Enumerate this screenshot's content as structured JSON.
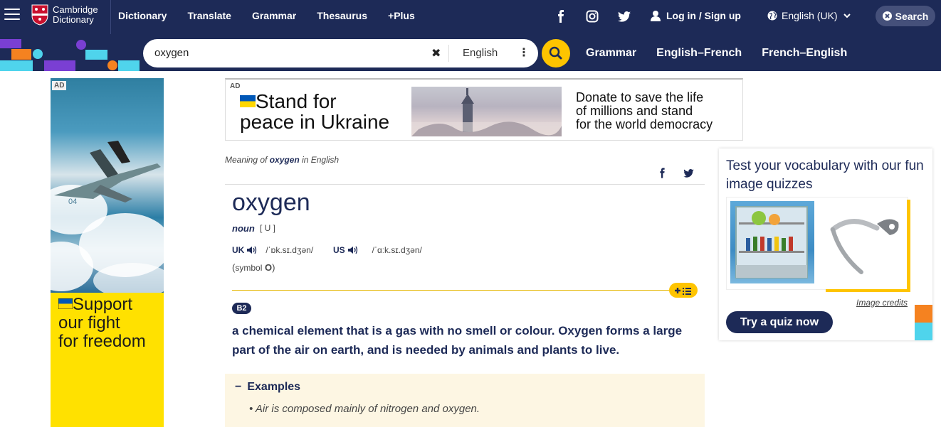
{
  "header": {
    "brand_line1": "Cambridge",
    "brand_line2": "Dictionary",
    "nav": [
      "Dictionary",
      "Translate",
      "Grammar",
      "Thesaurus",
      "+Plus"
    ],
    "login": "Log in / Sign up",
    "language": "English (UK)",
    "search_button": "Search",
    "social_icons": [
      "facebook-icon",
      "instagram-icon",
      "twitter-icon"
    ]
  },
  "search": {
    "value": "oxygen",
    "dictionary": "English",
    "links": [
      "Grammar",
      "English–French",
      "French–English"
    ]
  },
  "left_ad": {
    "tag": "AD",
    "text_line1": "Support",
    "text_line2": "our fight",
    "text_line3": "for freedom",
    "plane_number": "04"
  },
  "banner_ad": {
    "tag": "AD",
    "headline_line1": "Stand for",
    "headline_line2": "peace in Ukraine",
    "desc_line1": "Donate to save the life",
    "desc_line2": "of millions and stand",
    "desc_line3": "for the world democracy"
  },
  "entry": {
    "meaning_prefix": "Meaning of",
    "meaning_word": "oxygen",
    "meaning_suffix": "in English",
    "headword": "oxygen",
    "pos": "noun",
    "grammar": "[ U ]",
    "uk_label": "UK",
    "uk_ipa": "/ˈɒk.sɪ.dʒən/",
    "us_label": "US",
    "us_ipa": "/ˈɑːk.sɪ.dʒən/",
    "symbol_label": "symbol",
    "symbol_value": "O",
    "level": "B2",
    "definition": "a chemical element that is a gas with no smell or colour. Oxygen forms a large part of the air on earth, and is needed by animals and plants to live.",
    "examples_title": "Examples",
    "example1": "Air is composed mainly of nitrogen and oxygen."
  },
  "quiz": {
    "title": "Test your vocabulary with our fun image quizzes",
    "credits": "Image credits",
    "button": "Try a quiz now"
  },
  "colors": {
    "brand": "#1d2a57",
    "accent": "#fec400",
    "ukraine_blue": "#0057b7",
    "ukraine_yellow": "#ffd700",
    "examples_bg": "#fdf6e3"
  }
}
